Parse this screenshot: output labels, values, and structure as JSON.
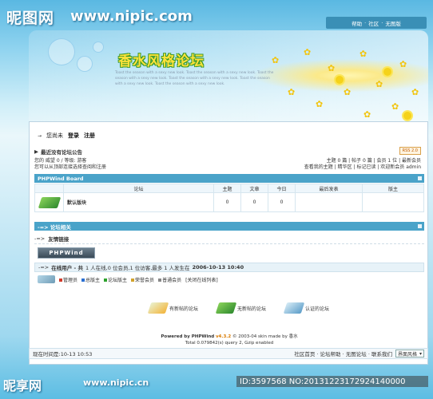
{
  "watermark": {
    "top_logo": "昵图网",
    "top_url": "www.nipic.com",
    "bottom_logo": "昵享网",
    "bottom_url": "www.nipic.cn",
    "id_text": "ID:3597568 NO:20131223172924140000"
  },
  "top_links": [
    "帮助",
    "社区",
    "无图版"
  ],
  "banner": {
    "title": "香水风格论坛",
    "text": "Toast the season with a sexy new look. Toast the season with a sexy new look. Toast the season with a sexy new look. Toast the season with a sexy new look. Toast the season with a sexy new look. Toast the season with a sexy new look."
  },
  "login": {
    "greeting": "您尚未",
    "login_label": "登录",
    "register_label": "注册"
  },
  "notice": {
    "label": "最近没有论坛公告"
  },
  "rss": "RSS 2.0",
  "user_info": {
    "line1": "您的 威望 0 / 等级: 游客",
    "line2": "您可以从顶部连接选择查阅和注册"
  },
  "stats": {
    "line1": "主题 0 篇 | 帖子 0 篇 | 会员 1 位 | 最新会员",
    "line2": "查看我的主题 | 精华区 | 标记已读 | 欢迎新会员 admin"
  },
  "board": {
    "title": "PHPWind Board",
    "columns": [
      "论坛",
      "主题",
      "文章",
      "今日",
      "最后发表",
      "版主"
    ],
    "rows": [
      {
        "name": "默认版块",
        "topics": "0",
        "posts": "0",
        "today": "0",
        "last": "",
        "mod": ""
      }
    ]
  },
  "related": {
    "title": "论坛相关",
    "links_label": "友情链接"
  },
  "pw_logo": "PHPWind",
  "online": {
    "prefix": "在线用户 - 共",
    "text": "1 人在线,0 位会员,1 位访客,最多 1 人发生在",
    "time": "2006-10-13 10:40"
  },
  "legend": {
    "items": [
      "管理员",
      "总版主",
      "论坛版主",
      "荣誉会员",
      "普通会员"
    ],
    "close_list": "[关闭在线列表]"
  },
  "bottom_legend": [
    "有新帖的论坛",
    "无新帖的论坛",
    "认证的论坛"
  ],
  "powered": {
    "line1": "Powered by PHPWind",
    "version": "v4.3.2",
    "line1_rest": "© 2003-04 skin made by 香水",
    "line2": "Total 0.079842(s) query 2,  Gzip enabled"
  },
  "footer": {
    "time": "现在时间是:10-13 10:53",
    "links": "社区首页 · 论坛帮助 · 无图论坛 · 联系我们",
    "style_label": "界面风格"
  },
  "colors": {
    "section_bar": "#4aa3c9",
    "title": "#ffe23a"
  }
}
